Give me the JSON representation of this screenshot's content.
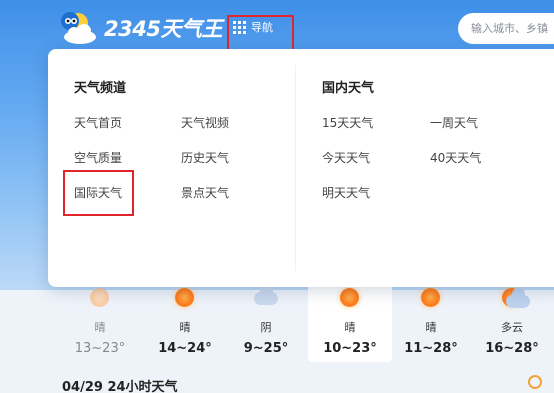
{
  "header": {
    "logo_text": "2345天气王",
    "nav_label": "导航",
    "search_placeholder": "输入城市、乡镇"
  },
  "dropdown": {
    "left_section": {
      "title": "天气频道",
      "col1": [
        "天气首页",
        "空气质量",
        "国际天气"
      ],
      "col2": [
        "天气视频",
        "历史天气",
        "景点天气"
      ]
    },
    "right_section": {
      "title": "国内天气",
      "col1": [
        "15天天气",
        "今天天气",
        "明天天气"
      ],
      "col2": [
        "一周天气",
        "40天天气"
      ]
    }
  },
  "forecast": [
    {
      "icon": "sun-icon",
      "condition": "晴",
      "temp": "13~23°",
      "past": true
    },
    {
      "icon": "sun-icon",
      "condition": "晴",
      "temp": "14~24°",
      "past": false
    },
    {
      "icon": "cloud-icon",
      "condition": "阴",
      "temp": "9~25°",
      "past": false
    },
    {
      "icon": "sun-icon",
      "condition": "晴",
      "temp": "10~23°",
      "past": false,
      "today": true
    },
    {
      "icon": "sun-icon",
      "condition": "晴",
      "temp": "11~28°",
      "past": false
    },
    {
      "icon": "partly-cloudy-icon",
      "condition": "多云",
      "temp": "16~28°",
      "past": false
    }
  ],
  "bottom": {
    "title": "04/29 24小时天气"
  },
  "colors": {
    "accent": "#3f8fe8",
    "highlight": "#e0262a",
    "sun": "#ff7a1c"
  }
}
